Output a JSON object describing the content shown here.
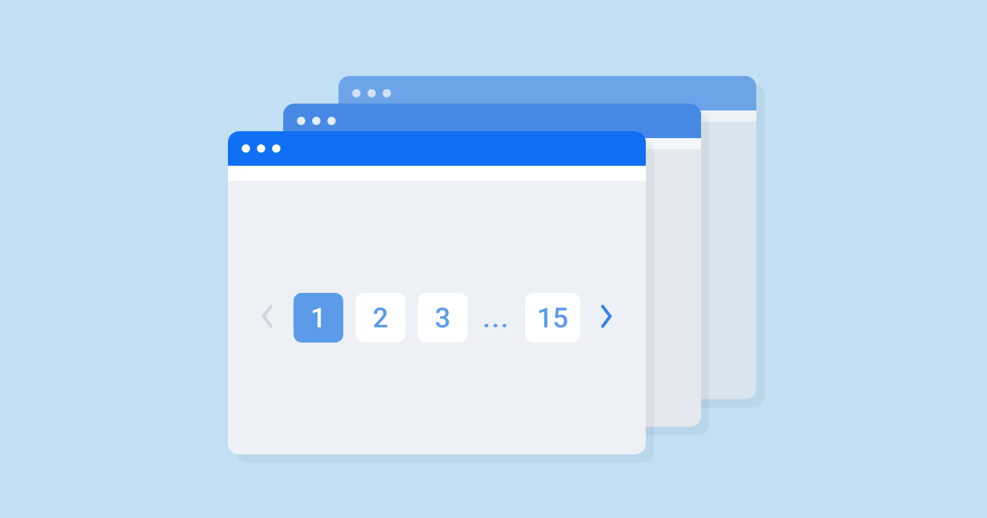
{
  "pagination": {
    "current_page": "1",
    "pages": {
      "p1": "1",
      "p2": "2",
      "p3": "3",
      "ellipsis": "...",
      "last": "15"
    },
    "prev_enabled": false,
    "next_enabled": true
  },
  "windows": {
    "count": 3
  }
}
